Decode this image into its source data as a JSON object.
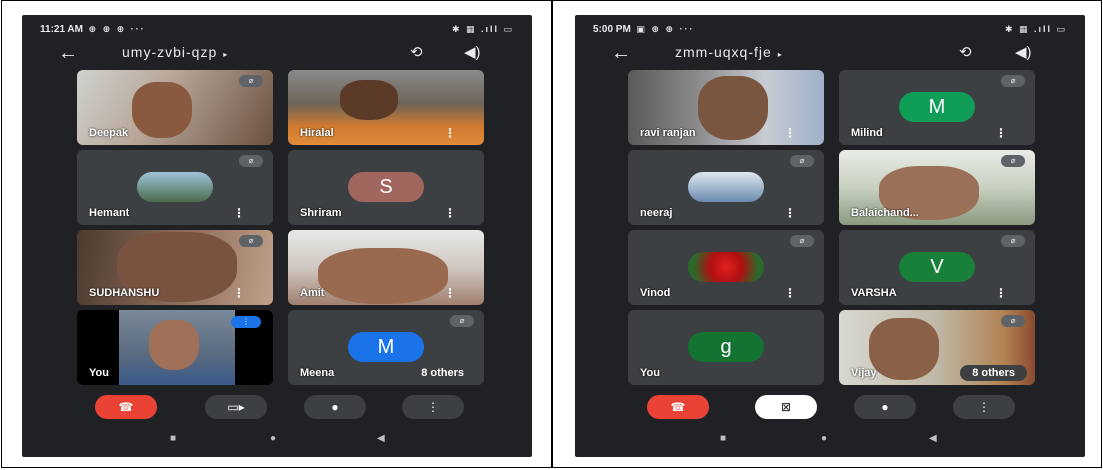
{
  "left": {
    "status": {
      "time": "11:21 AM",
      "notif": "⊕ ⊕ ⊕ ···",
      "sys": "✱ ▦ .ıll ▭"
    },
    "meeting_code": "umy-zvbi-qzp",
    "participants": [
      {
        "name": "Deepak"
      },
      {
        "name": "Hiralal"
      },
      {
        "name": "Hemant"
      },
      {
        "name": "Shriram",
        "initial": "S"
      },
      {
        "name": "SUDHANSHU"
      },
      {
        "name": "Amit"
      },
      {
        "name": "You"
      },
      {
        "name": "Meena",
        "initial": "M",
        "others": "8 others"
      }
    ]
  },
  "right": {
    "status": {
      "time": "5:00 PM",
      "notif": "▣ ⊕ ⊕ ···",
      "sys": "✱ ▦ .ıll ▭"
    },
    "meeting_code": "zmm-uqxq-fje",
    "participants": [
      {
        "name": "ravi ranjan"
      },
      {
        "name": "Milind",
        "initial": "M"
      },
      {
        "name": "neeraj"
      },
      {
        "name": "Balaichand..."
      },
      {
        "name": "Vinod"
      },
      {
        "name": "VARSHA",
        "initial": "V"
      },
      {
        "name": "You",
        "initial": "g"
      },
      {
        "name": "Vijay",
        "others": "8 others"
      }
    ]
  },
  "icons": {
    "back": "←",
    "caret": "▸",
    "camera_switch": "⟲",
    "speaker": "◀)",
    "mute": "⌀",
    "more": "⋮",
    "end_call": "☎",
    "camera": "▭▸",
    "camera_off": "⊠",
    "mic": "●",
    "more_options": "⋮",
    "nav_home": "●",
    "nav_back": "◀",
    "nav_recent": "■"
  },
  "colors": {
    "meet_bg": "#202124",
    "tile_bg": "#3c4043",
    "end_call": "#ea4335",
    "avatar_S": "#a1665e",
    "avatar_M_blue": "#1a73e8",
    "avatar_M_green": "#0f9d58",
    "avatar_V": "#188038",
    "avatar_g": "#137333"
  }
}
